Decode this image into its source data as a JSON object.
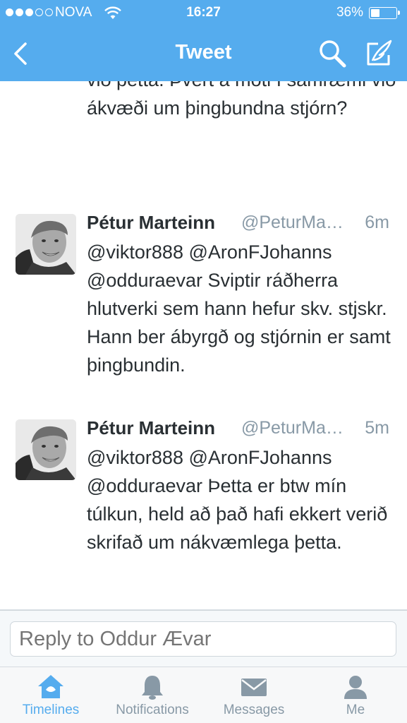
{
  "status_bar": {
    "carrier": "NOVA",
    "time": "16:27",
    "battery": "36%",
    "battery_level": 0.36
  },
  "nav": {
    "title": "Tweet"
  },
  "tweets": [
    {
      "text": "við þetta. Þvert á móti í samræmi við ákvæði um þingbundna stjórn?"
    },
    {
      "name": "Pétur Marteinn",
      "handle": "@PeturMa…",
      "time": "6m",
      "text": "@viktor888 @AronFJohanns @odduraevar Sviptir ráðherra hlutverki sem hann hefur skv. stjskr. Hann ber ábyrgð og stjórnin er samt þingbundin."
    },
    {
      "name": "Pétur Marteinn",
      "handle": "@PeturMa…",
      "time": "5m",
      "text": "@viktor888 @AronFJohanns @odduraevar Þetta er btw mín túlkun, held að það hafi ekkert verið skrifað um nákvæmlega þetta."
    }
  ],
  "reply": {
    "placeholder": "Reply to Oddur Ævar"
  },
  "tabs": [
    {
      "label": "Timelines",
      "icon": "home-icon",
      "active": true
    },
    {
      "label": "Notifications",
      "icon": "bell-icon",
      "active": false
    },
    {
      "label": "Messages",
      "icon": "envelope-icon",
      "active": false
    },
    {
      "label": "Me",
      "icon": "person-icon",
      "active": false
    }
  ],
  "colors": {
    "accent": "#55acee",
    "text": "#292f33",
    "muted": "#8899a6",
    "background": "#f5f8fa"
  }
}
